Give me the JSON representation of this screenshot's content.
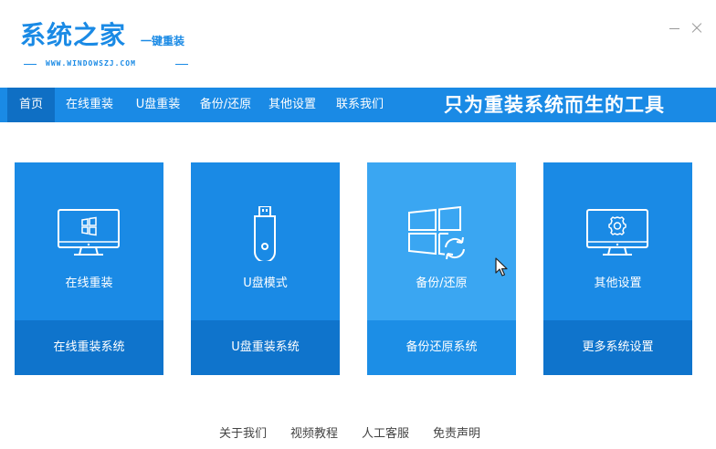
{
  "app": {
    "logo_text": "系统之家",
    "logo_sub": "一键重装",
    "logo_url": "WWW.WINDOWSZJ.COM"
  },
  "nav": {
    "items": [
      {
        "label": "首页",
        "active": true
      },
      {
        "label": "在线重装"
      },
      {
        "label": "U盘重装"
      },
      {
        "label": "备份/还原"
      },
      {
        "label": "其他设置"
      },
      {
        "label": "联系我们"
      }
    ],
    "slogan": "只为重装系统而生的工具"
  },
  "cards": [
    {
      "icon": "monitor-windows-icon",
      "title": "在线重装",
      "action": "在线重装系统"
    },
    {
      "icon": "usb-drive-icon",
      "title": "U盘模式",
      "action": "U盘重装系统"
    },
    {
      "icon": "windows-restore-icon",
      "title": "备份/还原",
      "action": "备份还原系统",
      "hover": true
    },
    {
      "icon": "monitor-gear-icon",
      "title": "其他设置",
      "action": "更多系统设置"
    }
  ],
  "footer": {
    "links": [
      "关于我们",
      "视频教程",
      "人工客服",
      "免责声明"
    ]
  },
  "colors": {
    "brand": "#1a8ae5",
    "nav_active": "#0f6fc4",
    "card_bottom": "#0f74cc",
    "card_hover": "#3aa6f2"
  }
}
